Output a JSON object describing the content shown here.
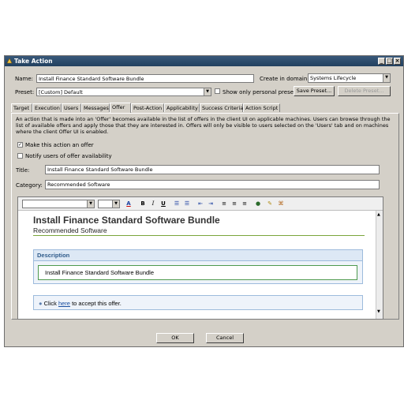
{
  "window": {
    "title": "Take Action",
    "minimize": "_",
    "maximize": "□",
    "close": "×"
  },
  "form": {
    "name_label": "Name:",
    "name_value": "Install Finance Standard Software Bundle",
    "domain_label": "Create in domain:",
    "domain_value": "Systems Lifecycle",
    "preset_label": "Preset:",
    "preset_value": "[Custom] Default",
    "personal_presets_label": "Show only personal presets",
    "save_preset": "Save Preset...",
    "delete_preset": "Delete Preset..."
  },
  "tabs": [
    "Target",
    "Execution",
    "Users",
    "Messages",
    "Offer",
    "Post-Action",
    "Applicability",
    "Success Criteria",
    "Action Script"
  ],
  "active_tab": "Offer",
  "offer": {
    "description": "An action that is made into an 'Offer' becomes available in the list of offers in the client UI on applicable machines. Users can browse through the list of available offers and apply those that they are interested in. Offers will only be visible to users selected on the 'Users' tab and on machines where the client Offer UI is enabled.",
    "make_offer_label": "Make this action an offer",
    "make_offer_checked": true,
    "notify_label": "Notify users of offer availability",
    "notify_checked": false,
    "title_label": "Title:",
    "title_value": "Install Finance Standard Software Bundle",
    "category_label": "Category:",
    "category_value": "Recommended Software"
  },
  "editor": {
    "heading": "Install Finance Standard Software Bundle",
    "subheading": "Recommended Software",
    "description_header": "Description",
    "description_text": "Install Finance Standard Software Bundle",
    "click_prefix": "Click ",
    "click_link": "here",
    "click_suffix": " to accept this offer.",
    "toolbar": {
      "bold": "B",
      "italic": "I",
      "underline": "U",
      "font_color": "A"
    }
  },
  "buttons": {
    "ok": "OK",
    "cancel": "Cancel"
  }
}
